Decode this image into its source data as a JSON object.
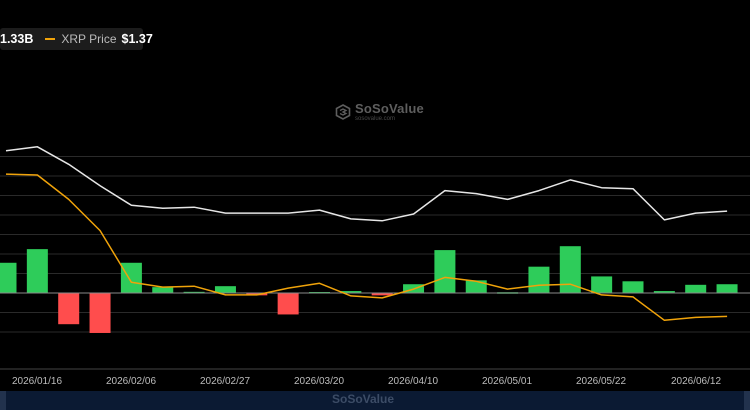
{
  "legend": {
    "item1_value": "1.33B",
    "item2_label": "XRP Price",
    "item2_value": "$1.37"
  },
  "watermark": {
    "name": "SoSoValue",
    "sub": "sosovalue.com"
  },
  "colors": {
    "white_line": "#e6e6e6",
    "price_line": "#f0a30a",
    "bar_positive": "#2ecc5a",
    "bar_negative": "#ff4d4d",
    "grid": "#2a2a2a"
  },
  "chart_data": {
    "type": "bar",
    "x": [
      "2026/01/09",
      "2026/01/16",
      "2026/01/23",
      "2026/01/30",
      "2026/02/06",
      "2026/02/13",
      "2026/02/20",
      "2026/02/27",
      "2026/03/06",
      "2026/03/13",
      "2026/03/20",
      "2026/03/27",
      "2026/04/03",
      "2026/04/10",
      "2026/04/17",
      "2026/04/24",
      "2026/05/01",
      "2026/05/08",
      "2026/05/15",
      "2026/05/22",
      "2026/05/29",
      "2026/06/05",
      "2026/06/12",
      "2026/06/19"
    ],
    "xticks": [
      "2026/01/16",
      "2026/02/06",
      "2026/02/27",
      "2026/03/20",
      "2026/04/10",
      "2026/05/01",
      "2026/05/22",
      "2026/06/12"
    ],
    "series": [
      {
        "type": "line",
        "values": [
          7.3,
          7.5,
          6.6,
          5.5,
          4.5,
          4.35,
          4.4,
          4.1,
          4.1,
          4.1,
          4.25,
          3.8,
          3.7,
          4.05,
          5.25,
          5.1,
          4.8,
          5.25,
          5.8,
          5.4,
          5.35,
          3.75,
          4.1,
          4.2
        ]
      },
      {
        "type": "line",
        "name": "XRP Price",
        "values": [
          6.1,
          6.05,
          4.8,
          3.2,
          0.55,
          0.3,
          0.35,
          -0.1,
          -0.1,
          0.25,
          0.5,
          -0.15,
          -0.25,
          0.2,
          0.8,
          0.6,
          0.2,
          0.4,
          0.45,
          -0.1,
          -0.2,
          -1.4,
          -1.25,
          -1.2
        ]
      },
      {
        "type": "bar",
        "values": [
          1.55,
          2.25,
          -1.6,
          -2.05,
          1.55,
          0.3,
          0.06,
          0.35,
          -0.12,
          -1.1,
          0.05,
          0.1,
          -0.12,
          0.45,
          2.2,
          0.65,
          0.04,
          1.35,
          2.4,
          0.85,
          0.6,
          0.1,
          0.42,
          0.45
        ]
      }
    ]
  }
}
